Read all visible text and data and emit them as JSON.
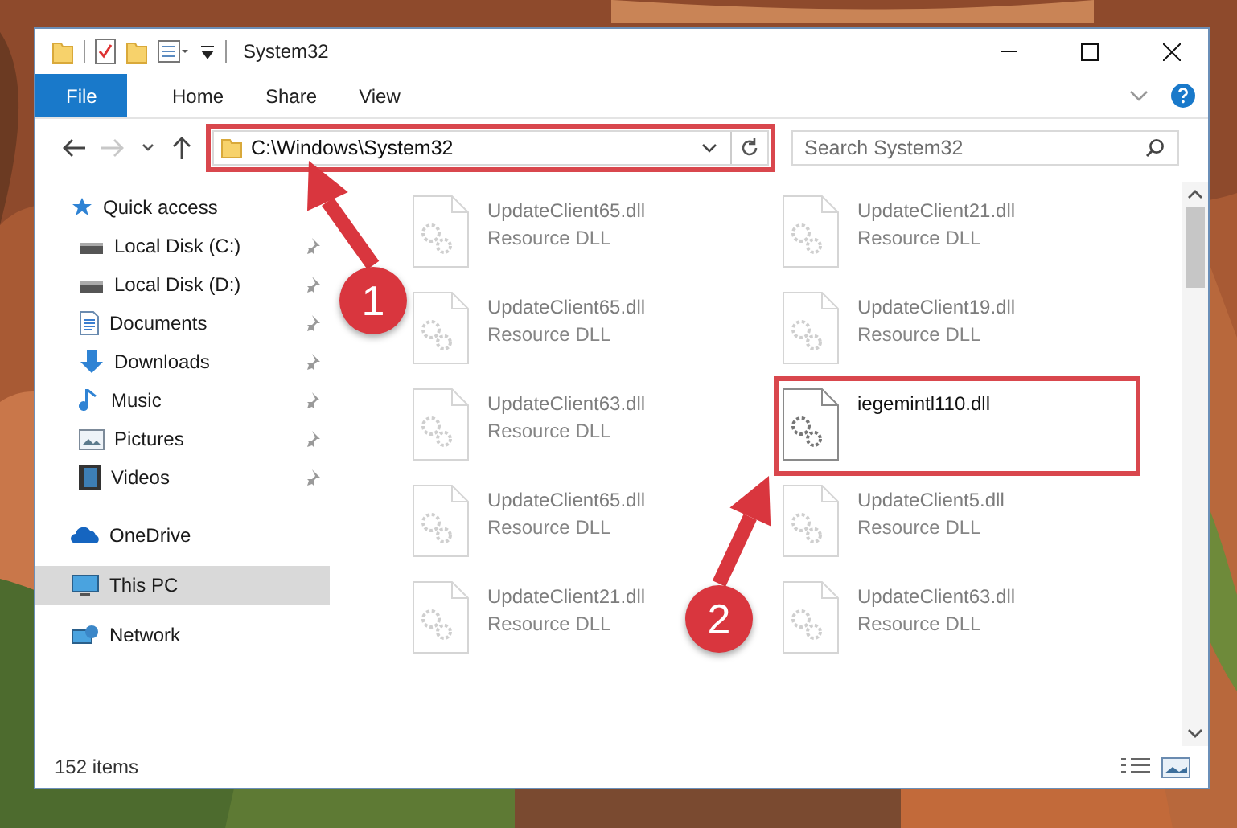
{
  "window": {
    "title": "System32"
  },
  "ribbon_tabs": [
    {
      "label": "File",
      "kind": "file"
    },
    {
      "label": "Home",
      "kind": "tab"
    },
    {
      "label": "Share",
      "kind": "tab"
    },
    {
      "label": "View",
      "kind": "tab"
    }
  ],
  "address_bar": {
    "path": "C:\\Windows\\System32",
    "highlighted": true
  },
  "search": {
    "placeholder": "Search System32"
  },
  "sidebar": {
    "items": [
      {
        "label": "Quick access",
        "kind": "star",
        "selected": false,
        "children": [
          {
            "label": "Local Disk (C:)",
            "kind": "disk",
            "pinned": true,
            "selected": false
          },
          {
            "label": "Local Disk (D:)",
            "kind": "disk",
            "pinned": true,
            "selected": false
          },
          {
            "label": "Documents",
            "kind": "documents",
            "pinned": true,
            "selected": false
          },
          {
            "label": "Downloads",
            "kind": "downloads",
            "pinned": true,
            "selected": false
          },
          {
            "label": "Music",
            "kind": "music",
            "pinned": true,
            "selected": false
          },
          {
            "label": "Pictures",
            "kind": "pictures",
            "pinned": true,
            "selected": false
          },
          {
            "label": "Videos",
            "kind": "videos",
            "pinned": true,
            "selected": false
          }
        ]
      },
      {
        "label": "OneDrive",
        "kind": "cloud",
        "selected": false
      },
      {
        "label": "This PC",
        "kind": "pc",
        "selected": true
      },
      {
        "label": "Network",
        "kind": "network",
        "selected": false
      }
    ]
  },
  "files": [
    {
      "name": "UpdateClient65.dll",
      "type": "Resource DLL",
      "dimmed": true,
      "highlighted": false
    },
    {
      "name": "UpdateClient21.dll",
      "type": "Resource DLL",
      "dimmed": true,
      "highlighted": false
    },
    {
      "name": "UpdateClient65.dll",
      "type": "Resource DLL",
      "dimmed": true,
      "highlighted": false
    },
    {
      "name": "UpdateClient19.dll",
      "type": "Resource DLL",
      "dimmed": true,
      "highlighted": false
    },
    {
      "name": "UpdateClient63.dll",
      "type": "Resource DLL",
      "dimmed": true,
      "highlighted": false
    },
    {
      "name": "iegemintl110.dll",
      "dimmed": false,
      "highlighted": true
    },
    {
      "name": "UpdateClient65.dll",
      "type": "Resource DLL",
      "dimmed": true,
      "highlighted": false
    },
    {
      "name": "UpdateClient5.dll",
      "type": "Resource DLL",
      "dimmed": true,
      "highlighted": false
    },
    {
      "name": "UpdateClient21.dll",
      "type": "Resource DLL",
      "dimmed": true,
      "highlighted": false
    },
    {
      "name": "UpdateClient63.dll",
      "type": "Resource DLL",
      "dimmed": true,
      "highlighted": false
    }
  ],
  "status_bar": {
    "text": "152 items"
  },
  "annotations": [
    {
      "number": "1"
    },
    {
      "number": "2"
    }
  ]
}
